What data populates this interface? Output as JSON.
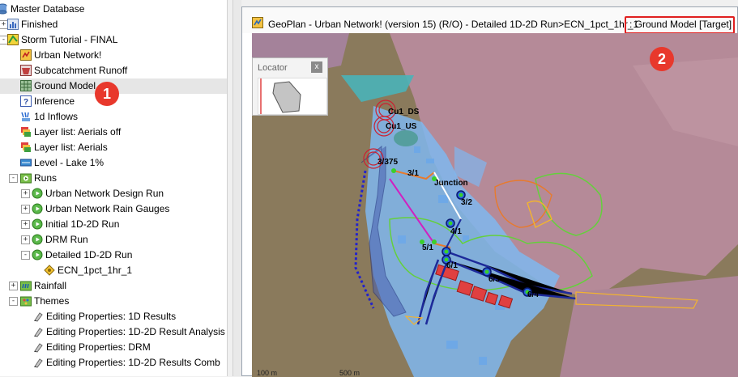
{
  "tree": {
    "items": [
      {
        "label": "Master Database",
        "icon": "database-icon",
        "level": 0,
        "expander": "",
        "selected": false
      },
      {
        "label": "Finished",
        "icon": "chart-icon",
        "level": 1,
        "expander": "+",
        "selected": false
      },
      {
        "label": "Storm Tutorial - FINAL",
        "icon": "network-group-icon",
        "level": 1,
        "expander": "-",
        "selected": false
      },
      {
        "label": "Urban Network!",
        "icon": "network-icon",
        "level": 2,
        "expander": "",
        "selected": false
      },
      {
        "label": "Subcatchment Runoff",
        "icon": "subcatchment-icon",
        "level": 2,
        "expander": "",
        "selected": false
      },
      {
        "label": "Ground Model",
        "icon": "ground-model-icon",
        "level": 2,
        "expander": "",
        "selected": true
      },
      {
        "label": "Inference",
        "icon": "inference-icon",
        "level": 2,
        "expander": "",
        "selected": false
      },
      {
        "label": "1d Inflows",
        "icon": "inflow-icon",
        "level": 2,
        "expander": "",
        "selected": false
      },
      {
        "label": "Layer list: Aerials off",
        "icon": "layer-list-icon",
        "level": 2,
        "expander": "",
        "selected": false
      },
      {
        "label": "Layer list: Aerials",
        "icon": "layer-list-icon",
        "level": 2,
        "expander": "",
        "selected": false
      },
      {
        "label": "Level - Lake 1%",
        "icon": "level-icon",
        "level": 2,
        "expander": "",
        "selected": false
      },
      {
        "label": "Runs",
        "icon": "runs-folder-icon",
        "level": 2,
        "expander": "-",
        "selected": false
      },
      {
        "label": "Urban Network Design Run",
        "icon": "run-icon",
        "level": 3,
        "expander": "+",
        "selected": false
      },
      {
        "label": "Urban Network Rain Gauges",
        "icon": "run-icon",
        "level": 3,
        "expander": "+",
        "selected": false
      },
      {
        "label": "Initial 1D-2D Run",
        "icon": "run-icon",
        "level": 3,
        "expander": "+",
        "selected": false
      },
      {
        "label": "DRM Run",
        "icon": "run-icon",
        "level": 3,
        "expander": "+",
        "selected": false
      },
      {
        "label": "Detailed 1D-2D Run",
        "icon": "run-icon",
        "level": 3,
        "expander": "-",
        "selected": false
      },
      {
        "label": "ECN_1pct_1hr_1",
        "icon": "sim-icon",
        "level": 4,
        "expander": "",
        "selected": false
      },
      {
        "label": "Rainfall",
        "icon": "rainfall-folder-icon",
        "level": 2,
        "expander": "+",
        "selected": false
      },
      {
        "label": "Themes",
        "icon": "themes-folder-icon",
        "level": 2,
        "expander": "-",
        "selected": false
      },
      {
        "label": "Editing Properties: 1D Results",
        "icon": "theme-icon",
        "level": 3,
        "expander": "",
        "selected": false
      },
      {
        "label": "Editing Properties: 1D-2D Result Analysis",
        "icon": "theme-icon",
        "level": 3,
        "expander": "",
        "selected": false
      },
      {
        "label": "Editing Properties: DRM",
        "icon": "theme-icon",
        "level": 3,
        "expander": "",
        "selected": false
      },
      {
        "label": "Editing Properties: 1D-2D Results Comb",
        "icon": "theme-icon",
        "level": 3,
        "expander": "",
        "selected": false
      }
    ]
  },
  "geoplan": {
    "title": "GeoPlan - Urban Network! (version 15) (R/O) - Detailed 1D-2D Run>ECN_1pct_1hr_1",
    "title_suffix": ": Ground Model  [Target]",
    "locator": {
      "title": "Locator",
      "close_glyph": "x"
    },
    "map_labels": [
      {
        "id": "cu1-ds",
        "text": "Cu1_DS"
      },
      {
        "id": "cu1-us",
        "text": "Cu1_US"
      },
      {
        "id": "node-3-375",
        "text": "3/375"
      },
      {
        "id": "node-3-1",
        "text": "3/1"
      },
      {
        "id": "junction",
        "text": "Junction"
      },
      {
        "id": "node-3-2",
        "text": "3/2"
      },
      {
        "id": "node-4-1",
        "text": "4/1"
      },
      {
        "id": "node-5-1",
        "text": "5/1"
      },
      {
        "id": "node-6-1",
        "text": "6/1"
      },
      {
        "id": "node-6-3",
        "text": "6/3"
      },
      {
        "id": "node-6-4",
        "text": "6/4"
      }
    ],
    "scale_labels": [
      "100 m",
      "500 m"
    ]
  },
  "callouts": [
    "1",
    "2"
  ],
  "colors": {
    "terrain_brown": "#8a7a5c",
    "terrain_pink": "#b58a98",
    "flood_blue": "#7fb7ef",
    "highlight_red": "#e02020",
    "callout_red": "#e8382c"
  }
}
